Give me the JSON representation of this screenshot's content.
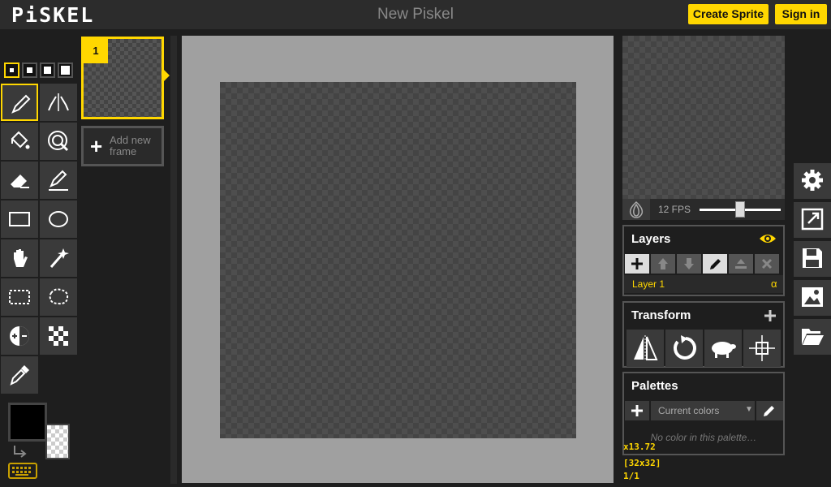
{
  "app": {
    "logo": "PiSKEL",
    "title": "New Piskel"
  },
  "header": {
    "create_sprite": "Create Sprite",
    "sign_in": "Sign in"
  },
  "frames": {
    "first_number": "1",
    "add_new_label": "Add new frame"
  },
  "preview": {
    "fps_label": "12 FPS",
    "fps_value": 12
  },
  "layers": {
    "title": "Layers",
    "layer_name": "Layer 1",
    "alpha_symbol": "α"
  },
  "transform": {
    "title": "Transform"
  },
  "palettes": {
    "title": "Palettes",
    "selected": "Current colors",
    "empty_message": "No color in this palette…"
  },
  "status": {
    "zoom": "x13.72",
    "size": "[32x32]",
    "frame": "1/1"
  },
  "colors": {
    "accent": "#ffd700",
    "primary": "#000000",
    "secondary": "transparent"
  }
}
